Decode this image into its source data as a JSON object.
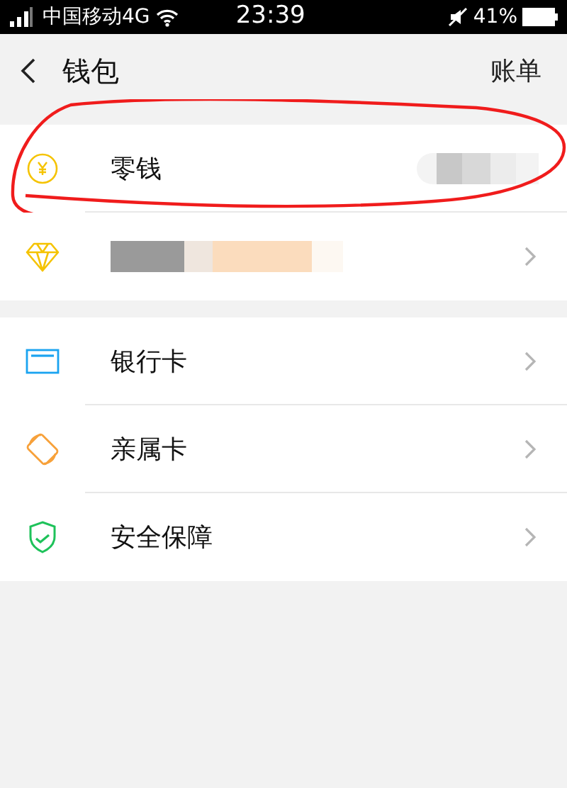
{
  "status_bar": {
    "carrier": "中国移动4G",
    "time": "23:39",
    "battery": "41%"
  },
  "header": {
    "title": "钱包",
    "action": "账单"
  },
  "sections": [
    {
      "rows": [
        {
          "kind": "coin",
          "label": "零钱",
          "label_redacted": false,
          "value_redacted": true,
          "chevron": false,
          "annotated": true
        },
        {
          "kind": "diamond",
          "label_redacted": true,
          "value_redacted": false,
          "chevron": true,
          "annotated": false
        }
      ]
    },
    {
      "rows": [
        {
          "kind": "bank_card",
          "label": "银行卡",
          "label_redacted": false,
          "value_redacted": false,
          "chevron": true,
          "annotated": false
        },
        {
          "kind": "family_card",
          "label": "亲属卡",
          "label_redacted": false,
          "value_redacted": false,
          "chevron": true,
          "annotated": false
        },
        {
          "kind": "shield",
          "label": "安全保障",
          "label_redacted": false,
          "value_redacted": false,
          "chevron": true,
          "annotated": false
        }
      ]
    }
  ]
}
